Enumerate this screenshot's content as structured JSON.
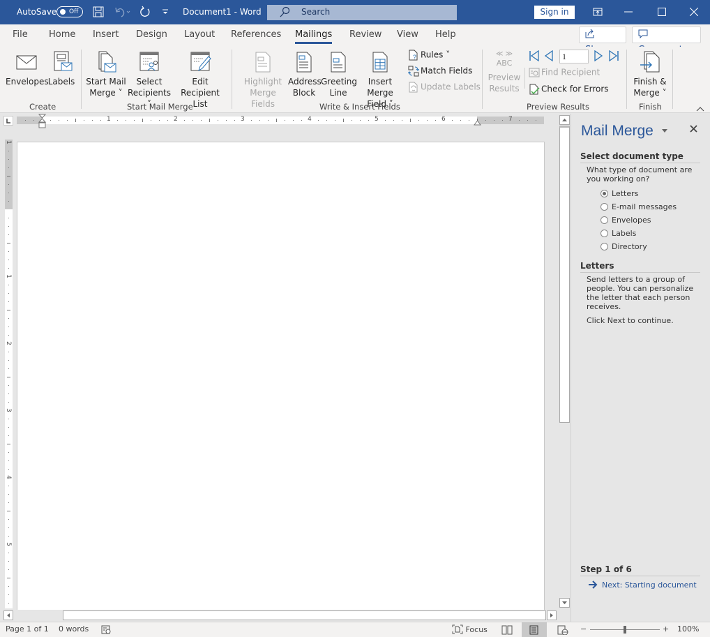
{
  "titlebar": {
    "autosave_label": "AutoSave",
    "autosave_state": "Off",
    "document_title": "Document1  -  Word",
    "search_placeholder": "Search",
    "signin_label": "Sign in"
  },
  "tabs": [
    {
      "label": "File"
    },
    {
      "label": "Home"
    },
    {
      "label": "Insert"
    },
    {
      "label": "Design"
    },
    {
      "label": "Layout"
    },
    {
      "label": "References"
    },
    {
      "label": "Mailings",
      "active": true
    },
    {
      "label": "Review"
    },
    {
      "label": "View"
    },
    {
      "label": "Help"
    }
  ],
  "header_buttons": {
    "share": "Share",
    "comments": "Comments"
  },
  "ribbon": {
    "groups": {
      "create": "Create",
      "start_mail_merge": "Start Mail Merge",
      "write_insert": "Write & Insert Fields",
      "preview_results": "Preview Results",
      "finish": "Finish"
    },
    "envelopes": "Envelopes",
    "labels": "Labels",
    "start_mail_merge_1": "Start Mail",
    "start_mail_merge_2": "Merge ˅",
    "select_recipients_1": "Select",
    "select_recipients_2": "Recipients ˅",
    "edit_list_1": "Edit",
    "edit_list_2": "Recipient List",
    "highlight_1": "Highlight",
    "highlight_2": "Merge Fields",
    "address_1": "Address",
    "address_2": "Block",
    "greeting_1": "Greeting",
    "greeting_2": "Line",
    "insert_field_1": "Insert Merge",
    "insert_field_2": "Field ˅",
    "rules": "Rules ˅",
    "match_fields": "Match Fields",
    "update_labels": "Update Labels",
    "preview_abc": "ABC",
    "preview_1": "Preview",
    "preview_2": "Results",
    "record_number": "1",
    "find_recipient": "Find Recipient",
    "check_errors": "Check for Errors",
    "finish_1": "Finish &",
    "finish_2": "Merge ˅"
  },
  "ruler": {
    "h_labels": [
      "1",
      "2",
      "3",
      "4",
      "5",
      "6",
      "7"
    ],
    "v_labels": [
      "1",
      "1",
      "2",
      "3",
      "4",
      "5"
    ]
  },
  "pane": {
    "title": "Mail Merge",
    "section1_heading": "Select document type",
    "question": "What type of document are you working on?",
    "options": [
      {
        "label": "Letters",
        "selected": true
      },
      {
        "label": "E-mail messages",
        "selected": false
      },
      {
        "label": "Envelopes",
        "selected": false
      },
      {
        "label": "Labels",
        "selected": false
      },
      {
        "label": "Directory",
        "selected": false
      }
    ],
    "section2_heading": "Letters",
    "description": "Send letters to a group of people. You can personalize the letter that each person receives.",
    "instruction": "Click Next to continue.",
    "step": "Step 1 of 6",
    "next_link": "Next: Starting document"
  },
  "status": {
    "page": "Page 1 of 1",
    "words": "0 words",
    "focus": "Focus",
    "zoom_level": "100%",
    "zoom_percent": 100
  },
  "colors": {
    "accent": "#2b579a",
    "icon_blue": "#2e75b6"
  }
}
